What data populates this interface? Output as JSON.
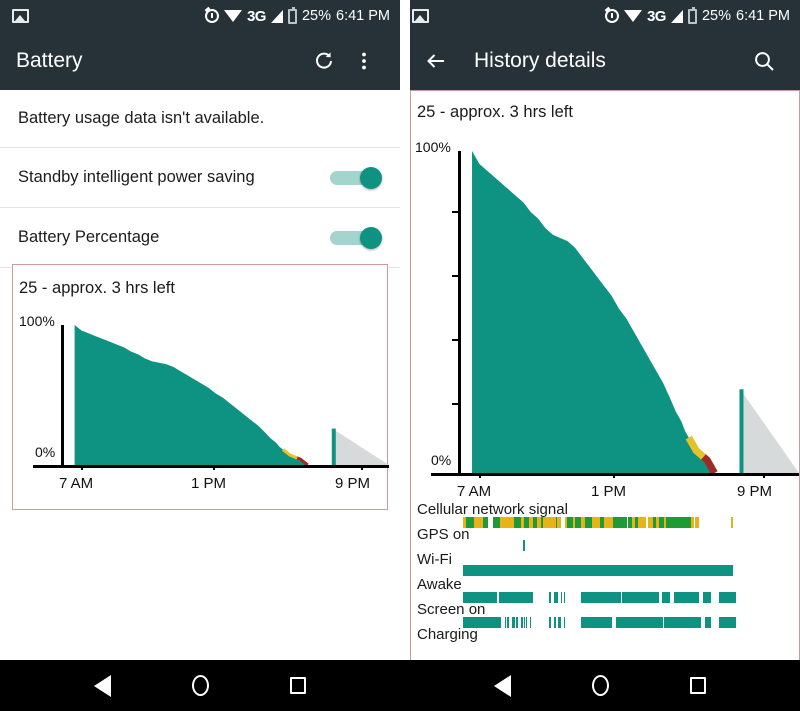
{
  "status_bar": {
    "photo_icon": "photo-icon",
    "alarm_icon": "alarm-icon",
    "wifi_icon": "wifi-icon",
    "network_type": "3G",
    "signal_icon": "signal-icon",
    "battery_icon": "battery-icon",
    "battery_percent": "25%",
    "time": "6:41 PM"
  },
  "left_pane": {
    "appbar": {
      "title": "Battery",
      "refresh_icon": "refresh-icon",
      "overflow_icon": "overflow-menu-icon"
    },
    "list": [
      {
        "label": "Battery usage data isn't available.",
        "has_switch": false
      },
      {
        "label": "Standby intelligent power saving",
        "has_switch": true,
        "switch_on": true
      },
      {
        "label": "Battery Percentage",
        "has_switch": true,
        "switch_on": true
      }
    ]
  },
  "right_pane": {
    "appbar": {
      "title": "History details",
      "back_icon": "back-arrow-icon",
      "search_icon": "search-icon"
    },
    "timelines": [
      {
        "label": "Cellular network signal",
        "type": "signal"
      },
      {
        "label": "GPS on",
        "type": "bars"
      },
      {
        "label": "Wi-Fi",
        "type": "bars"
      },
      {
        "label": "Awake",
        "type": "bars"
      },
      {
        "label": "Screen on",
        "type": "bars"
      },
      {
        "label": "Charging",
        "type": "bars"
      }
    ]
  },
  "colors": {
    "appbar_bg": "#263238",
    "accent_teal": "#0e9382",
    "card_border": "#cb9a99",
    "projection_gray": "#d7dadb",
    "warn_yellow": "#e5c12a",
    "warn_red": "#9e2b25",
    "signal_green": "#1f9b35",
    "signal_yellow": "#e8b317"
  },
  "chart_data": {
    "type": "area",
    "title": "25 - approx. 3 hrs left",
    "xlabel": "",
    "ylabel": "",
    "ylim": [
      0,
      100
    ],
    "ytick_labels": [
      "100%",
      "0%"
    ],
    "xtick_labels": [
      "7 AM",
      "1 PM",
      "9 PM"
    ],
    "xtick_positions": [
      0.07,
      0.5,
      0.93
    ],
    "grid": false,
    "legend": "none",
    "series": [
      {
        "name": "Battery level",
        "color": "#0e9382",
        "x": [
          0.07,
          0.09,
          0.11,
          0.13,
          0.15,
          0.17,
          0.19,
          0.21,
          0.23,
          0.25,
          0.27,
          0.29,
          0.31,
          0.33,
          0.35,
          0.37,
          0.39,
          0.41,
          0.43,
          0.45,
          0.47,
          0.49,
          0.51,
          0.53,
          0.55,
          0.57,
          0.59,
          0.61,
          0.625,
          0.64,
          0.65,
          0.66,
          0.67,
          0.68,
          0.69,
          0.7,
          0.71,
          0.72,
          0.73
        ],
        "values": [
          100,
          96,
          94,
          92,
          90,
          88,
          86,
          84,
          81,
          79,
          76,
          74,
          73,
          72,
          70,
          67,
          64,
          61,
          58,
          55,
          51,
          48,
          44,
          40,
          36,
          32,
          28,
          23,
          19,
          16,
          13,
          11,
          9,
          7,
          6,
          5,
          4,
          2,
          0
        ]
      },
      {
        "name": "Projection",
        "color": "#d7dadb",
        "x": [
          0.8,
          0.8,
          0.96
        ],
        "values": [
          0,
          26,
          0
        ]
      },
      {
        "name": "Current level marker",
        "color": "#0e9382",
        "x": [
          0.798,
          0.806
        ],
        "values": [
          26,
          26
        ]
      }
    ],
    "annotations": [
      {
        "text": "low battery warning edge",
        "color": "#e5c12a",
        "x_range": [
          0.66,
          0.71
        ]
      },
      {
        "text": "critical battery edge",
        "color": "#9e2b25",
        "x_range": [
          0.7,
          0.73
        ]
      }
    ]
  }
}
